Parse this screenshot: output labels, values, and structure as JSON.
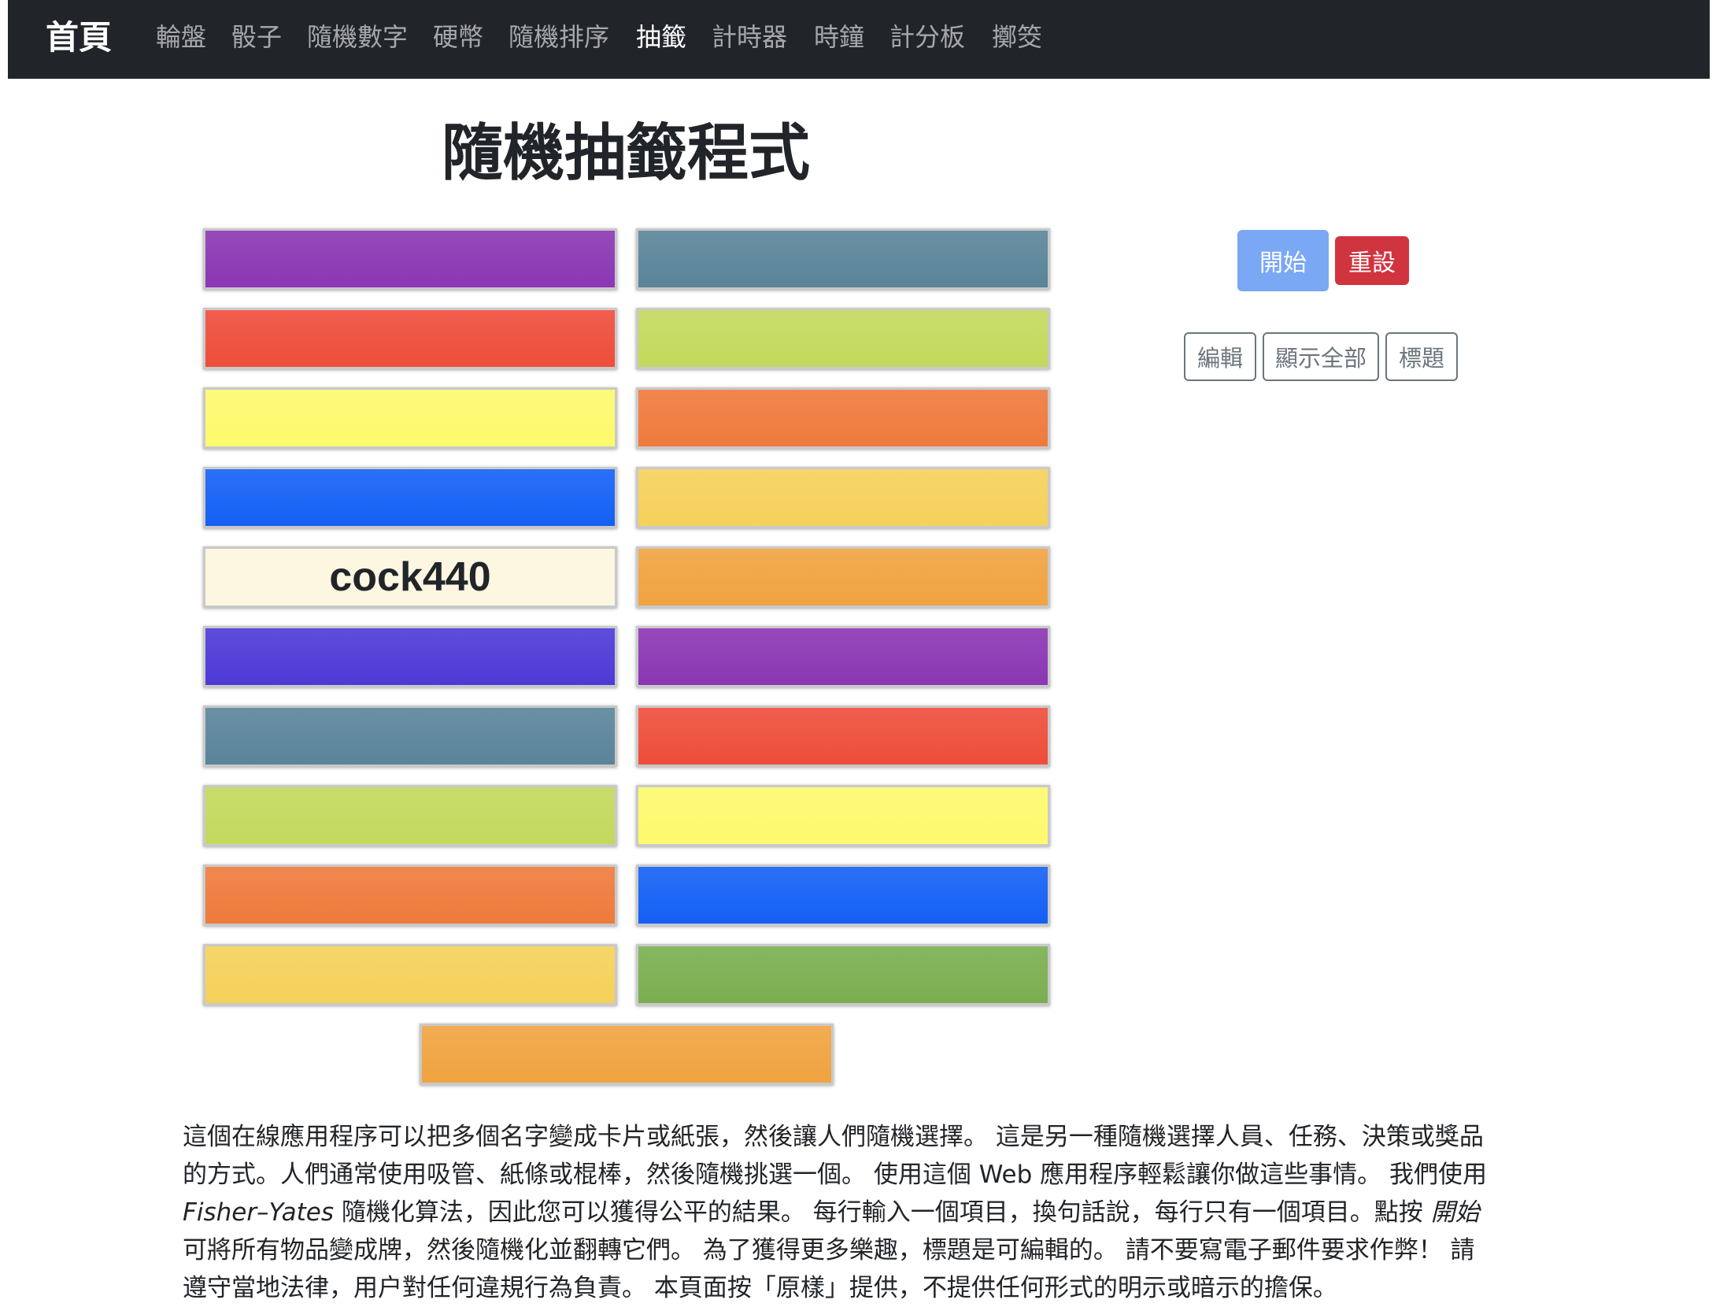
{
  "navbar": {
    "brand": "首頁",
    "links": [
      "輪盤",
      "骰子",
      "隨機數字",
      "硬幣",
      "隨機排序",
      "抽籤",
      "計時器",
      "時鐘",
      "計分板",
      "擲筊"
    ],
    "active": "抽籤"
  },
  "title": "隨機抽籤程式",
  "cards": [
    {
      "color": "#8b36b3",
      "label": ""
    },
    {
      "color": "#5a8499",
      "label": ""
    },
    {
      "color": "#ee4d3a",
      "label": ""
    },
    {
      "color": "#c2d95c",
      "label": ""
    },
    {
      "color": "#fdfa6d",
      "label": ""
    },
    {
      "color": "#ef7a3c",
      "label": ""
    },
    {
      "color": "#1460f5",
      "label": ""
    },
    {
      "color": "#f5d15a",
      "label": ""
    },
    {
      "color": "#fdf6e1",
      "label": "cock440"
    },
    {
      "color": "#f0a340",
      "label": ""
    },
    {
      "color": "#4d3ad6",
      "label": ""
    },
    {
      "color": "#8b36b3",
      "label": ""
    },
    {
      "color": "#5a8499",
      "label": ""
    },
    {
      "color": "#ee4d3a",
      "label": ""
    },
    {
      "color": "#c2d95c",
      "label": ""
    },
    {
      "color": "#fdfa6d",
      "label": ""
    },
    {
      "color": "#ef7a3c",
      "label": ""
    },
    {
      "color": "#1460f5",
      "label": ""
    },
    {
      "color": "#f5d15a",
      "label": ""
    },
    {
      "color": "#7aae4f",
      "label": ""
    },
    {
      "color": "#f0a340",
      "label": ""
    }
  ],
  "buttons": {
    "start": "開始",
    "reset": "重設",
    "edit": "編輯",
    "show_all": "顯示全部",
    "heading": "標題"
  },
  "description": {
    "line1": "這個在線應用程序可以把多個名字變成卡片或紙張，然後讓人們隨機選擇。 這是另一種隨機選擇人員、任務、決策或獎品",
    "line2": "的方式。人們通常使用吸管、紙條或棍棒，然後隨機挑選一個。 使用這個 Web 應用程序輕鬆讓你做這些事情。 我們使用",
    "line3_em": "Fisher–Yates",
    "line3_rest": " 隨機化算法，因此您可以獲得公平的結果。 每行輸入一個項目，換句話說，每行只有一個項目。點按 ",
    "line3_em2": "開始",
    "line4": "可將所有物品變成牌，然後隨機化並翻轉它們。 為了獲得更多樂趣，標題是可編輯的。 請不要寫電子郵件要求作弊！ 請",
    "line5": "遵守當地法律，用户對任何違規行為負責。 本頁面按「原樣」提供，不提供任何形式的明示或暗示的擔保。"
  }
}
